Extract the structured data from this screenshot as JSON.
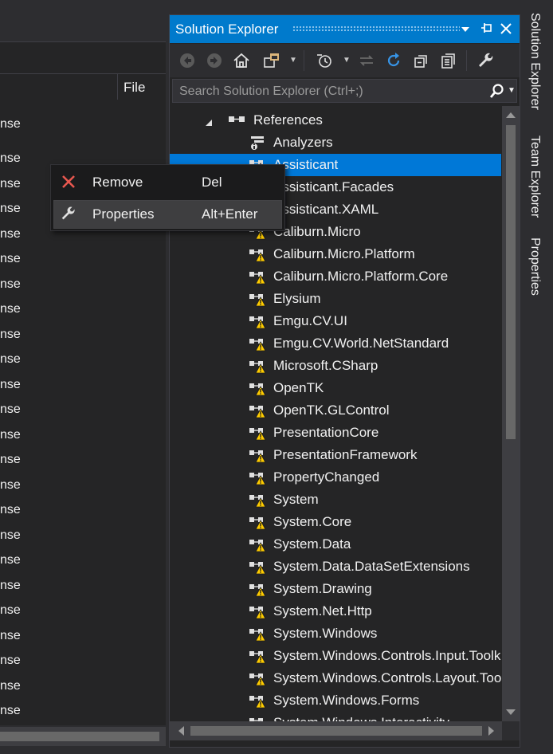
{
  "left_pane": {
    "column_header": "File",
    "row_text": "nse",
    "row_count": 24
  },
  "solution_explorer": {
    "title": "Solution Explorer",
    "search_placeholder": "Search Solution Explorer (Ctrl+;)",
    "references_label": "References",
    "analyzers_label": "Analyzers",
    "items": [
      "Assisticant",
      "Assisticant.Facades",
      "Assisticant.XAML",
      "Caliburn.Micro",
      "Caliburn.Micro.Platform",
      "Caliburn.Micro.Platform.Core",
      "Elysium",
      "Emgu.CV.UI",
      "Emgu.CV.World.NetStandard",
      "Microsoft.CSharp",
      "OpenTK",
      "OpenTK.GLControl",
      "PresentationCore",
      "PresentationFramework",
      "PropertyChanged",
      "System",
      "System.Core",
      "System.Data",
      "System.Data.DataSetExtensions",
      "System.Drawing",
      "System.Net.Http",
      "System.Windows",
      "System.Windows.Controls.Input.Toolkit",
      "System.Windows.Controls.Layout.Toolkit",
      "System.Windows.Forms",
      "System.Windows.Interactivity"
    ],
    "selected_item": "Assisticant"
  },
  "side_tabs": {
    "solution_explorer": "Solution Explorer",
    "team_explorer": "Team Explorer",
    "properties": "Properties"
  },
  "context_menu": {
    "remove_label": "Remove",
    "remove_shortcut": "Del",
    "properties_label": "Properties",
    "properties_shortcut": "Alt+Enter"
  },
  "colors": {
    "accent": "#007acc",
    "selection": "#0078d7",
    "background": "#252526",
    "warning": "#ffcc00",
    "remove_x": "#e8584f"
  },
  "icons": {
    "title_menu": "dropdown-icon",
    "title_pin": "pin-icon",
    "title_close": "close-icon",
    "toolbar": [
      "back-icon",
      "forward-icon",
      "home-icon",
      "switch-views-icon",
      "pending-changes-icon",
      "sync-icon",
      "refresh-icon",
      "collapse-all-icon",
      "show-all-files-icon",
      "properties-wrench-icon"
    ],
    "reference": "reference-warning-icon"
  }
}
